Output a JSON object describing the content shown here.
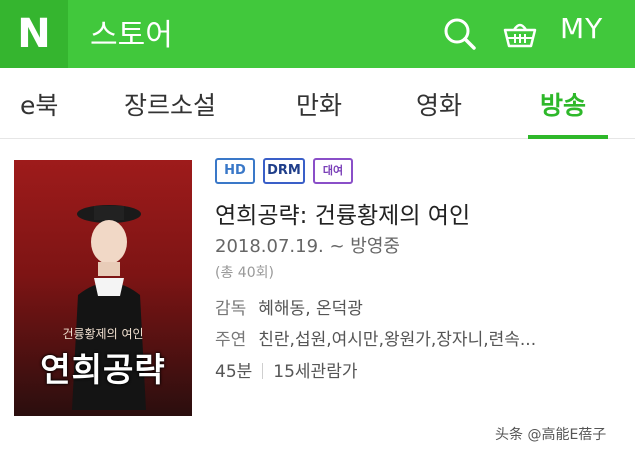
{
  "header": {
    "logo": "N",
    "title": "스토어",
    "my_label": "MY",
    "icons": [
      "search-icon",
      "basket-icon"
    ],
    "brand_color": "#41c83c"
  },
  "tabs": [
    {
      "label": "e북",
      "active": false
    },
    {
      "label": "장르소설",
      "active": false
    },
    {
      "label": "만화",
      "active": false
    },
    {
      "label": "영화",
      "active": false
    },
    {
      "label": "방송",
      "active": true
    }
  ],
  "product": {
    "badges": [
      "HD",
      "DRM",
      "대여"
    ],
    "title": "연희공략: 건륭황제의 여인",
    "airdate": "2018.07.19. ~ 방영중",
    "episodes": "(총 40회)",
    "director_label": "감독",
    "director": "혜해동, 온덕광",
    "cast_label": "주연",
    "cast": "친란,섭원,여시만,왕원가,장자니,련속...",
    "duration": "45분",
    "rating": "15세관람가",
    "cover": {
      "subtitle": "건륭황제의 여인",
      "title": "연희공략"
    }
  },
  "watermark": "头条 @高能E蓓子"
}
